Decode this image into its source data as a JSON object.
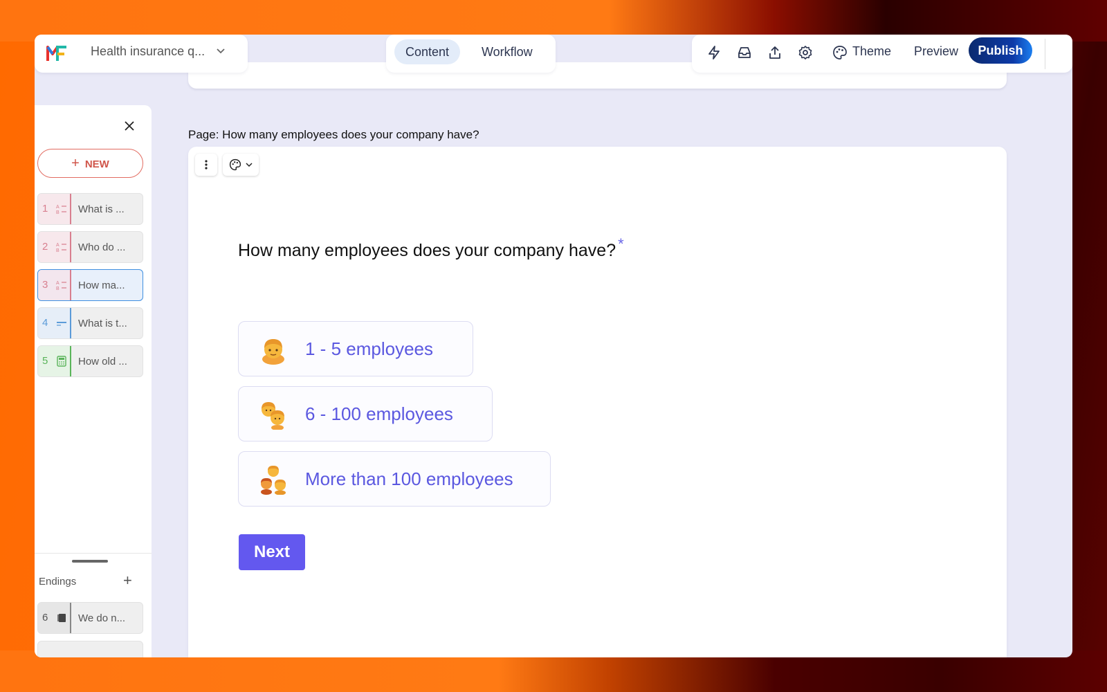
{
  "header": {
    "form_title": "Health insurance q...",
    "tabs": [
      {
        "label": "Content",
        "active": true
      },
      {
        "label": "Workflow",
        "active": false
      }
    ],
    "theme_label": "Theme",
    "preview_label": "Preview",
    "publish_label": "Publish",
    "icons": [
      "bolt-icon",
      "inbox-icon",
      "share-icon",
      "settings-icon",
      "palette-icon"
    ]
  },
  "sidebar": {
    "new_label": "NEW",
    "questions": [
      {
        "num": "1",
        "text": "What is ...",
        "type": "multiple-choice",
        "color": "#d87f8f"
      },
      {
        "num": "2",
        "text": "Who do ...",
        "type": "multiple-choice",
        "color": "#d87f8f"
      },
      {
        "num": "3",
        "text": "How ma...",
        "type": "multiple-choice",
        "color": "#d87f8f",
        "active": true
      },
      {
        "num": "4",
        "text": "What is t...",
        "type": "short-text",
        "color": "#5b9bd8"
      },
      {
        "num": "5",
        "text": "How old ...",
        "type": "number",
        "color": "#5ab45a"
      }
    ],
    "endings_label": "Endings",
    "endings": [
      {
        "num": "6",
        "text": "We do n..."
      }
    ]
  },
  "page": {
    "prefix": "Page:",
    "title": "How many employees does your company have?"
  },
  "question": {
    "text": "How many employees does your company have?",
    "required_mark": "*",
    "options": [
      {
        "label": "1 - 5 employees",
        "icon": "person-emoji"
      },
      {
        "label": "6 - 100 employees",
        "icon": "two-people-emoji"
      },
      {
        "label": "More than 100 employees",
        "icon": "group-emoji"
      }
    ],
    "next_label": "Next"
  },
  "colors": {
    "accent": "#6358ef",
    "option_text": "#5b58e0",
    "publish": "#0d3aa8"
  }
}
